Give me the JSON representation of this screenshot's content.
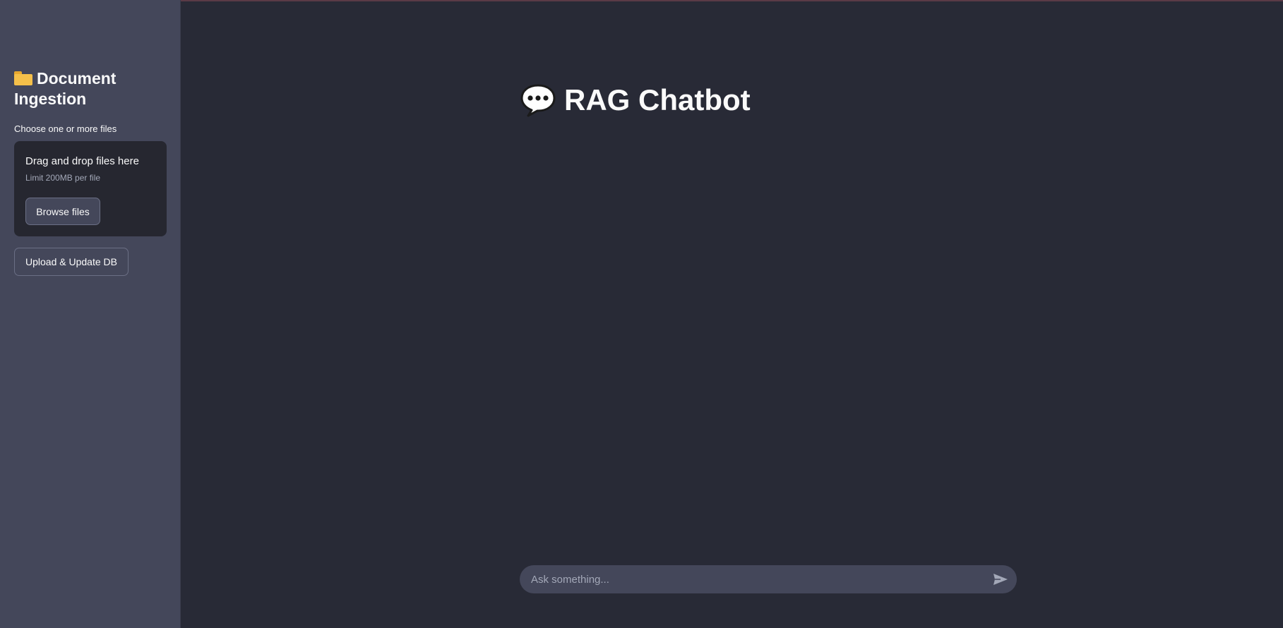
{
  "sidebar": {
    "title": "Document Ingestion",
    "title_icon": "folder-icon",
    "uploader": {
      "label": "Choose one or more files",
      "dropzone_title": "Drag and drop files here",
      "dropzone_limit": "Limit 200MB per file",
      "browse_label": "Browse files"
    },
    "upload_button_label": "Upload & Update DB"
  },
  "main": {
    "title": "RAG Chatbot",
    "title_icon": "speech-bubble-icon"
  },
  "chat": {
    "placeholder": "Ask something...",
    "send_icon": "send-icon"
  },
  "colors": {
    "background": "#282a36",
    "sidebar": "#44475a",
    "dropzone": "#262730",
    "text": "#fafafa",
    "muted_text": "#a3a8b8"
  }
}
